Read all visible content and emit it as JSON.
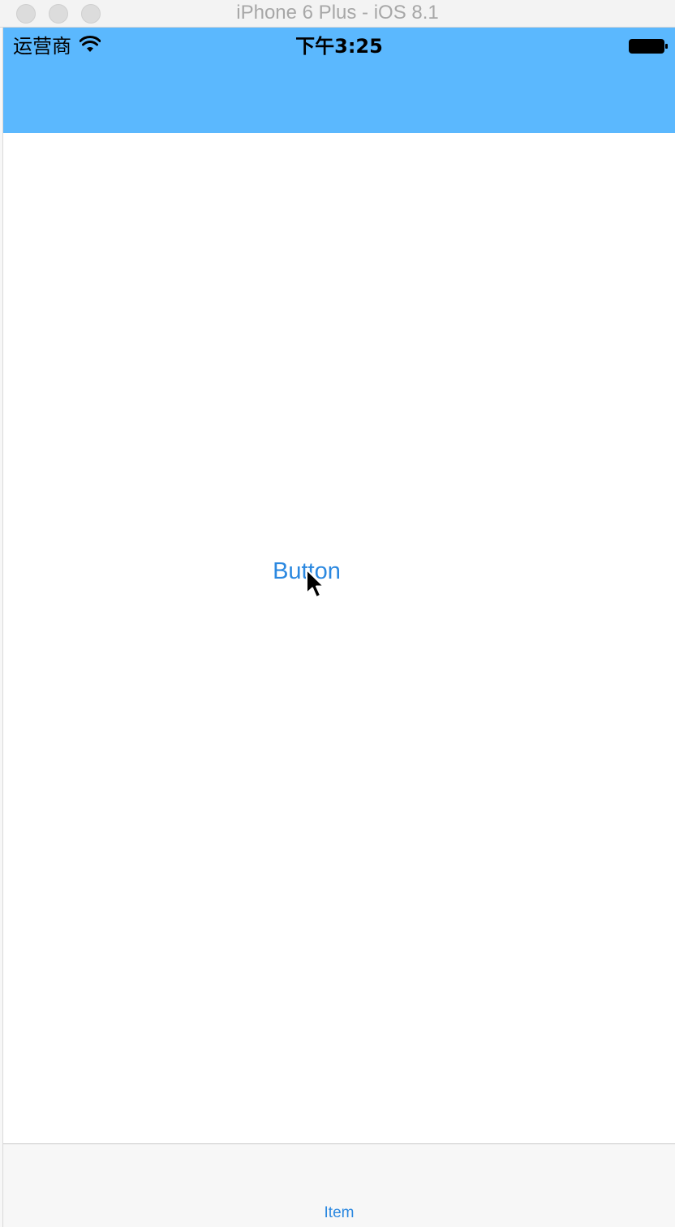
{
  "window": {
    "title": "iPhone 6 Plus - iOS 8.1"
  },
  "status_bar": {
    "carrier": "运营商",
    "time": "下午3:25",
    "wifi_icon": "wifi-icon",
    "battery_icon": "battery-icon"
  },
  "navbar": {
    "background_color": "#5bb8fe"
  },
  "main": {
    "button_label": "Button",
    "button_color": "#2b88e0"
  },
  "tabbar": {
    "items": [
      {
        "label": "Item"
      }
    ]
  }
}
